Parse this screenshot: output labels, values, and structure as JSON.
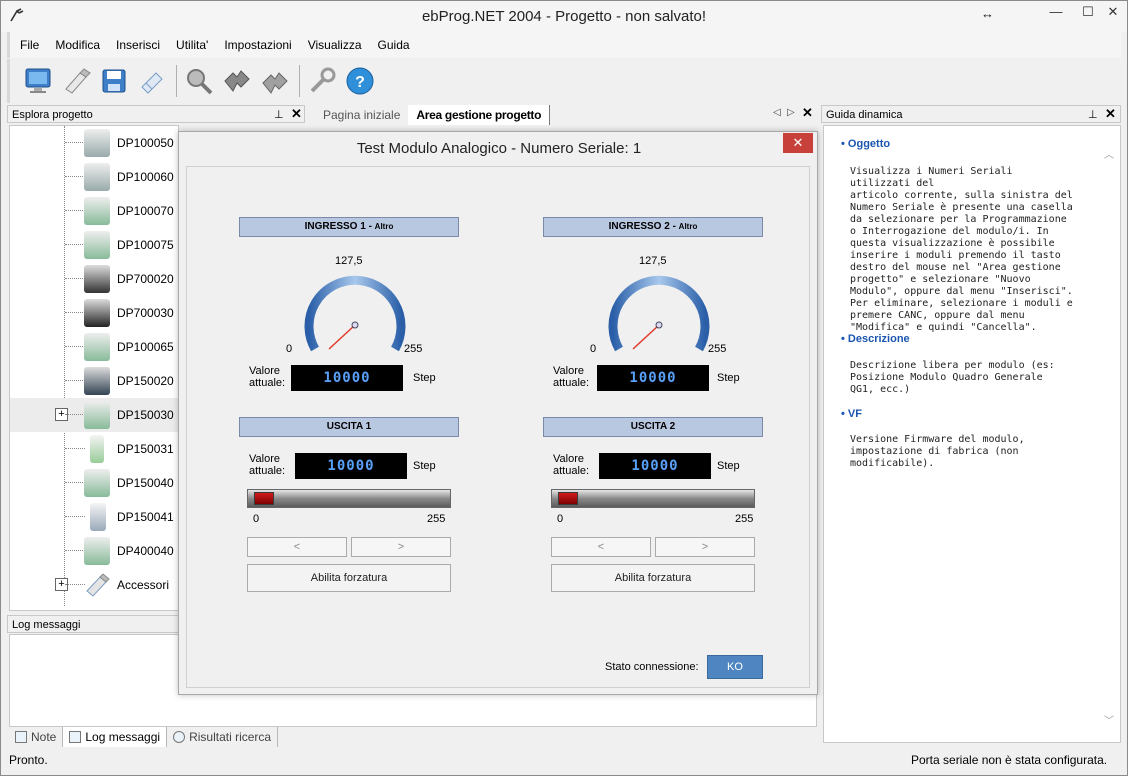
{
  "window": {
    "title": "ebProg.NET 2004 - Progetto - non salvato!"
  },
  "menu": [
    "File",
    "Modifica",
    "Inserisci",
    "Utilita'",
    "Impostazioni",
    "Visualizza",
    "Guida"
  ],
  "toolbar": [
    "monitor-icon",
    "usb-icon",
    "save-icon",
    "usb-eraser-icon",
    "search-icon",
    "puzzle-icon",
    "puzzle-gray-icon",
    "wrench-icon",
    "help-icon"
  ],
  "left_panel": {
    "title": "Esplora progetto",
    "items": [
      "DP100050",
      "DP100060",
      "DP100070",
      "DP100075",
      "DP700020",
      "DP700030",
      "DP100065",
      "DP150020",
      "DP150030",
      "DP150031",
      "DP150040",
      "DP150041",
      "DP400040",
      "Accessori"
    ]
  },
  "log_panel": {
    "title": "Log messaggi"
  },
  "bottom_tabs": [
    "Note",
    "Log messaggi",
    "Risultati ricerca"
  ],
  "doc_tabs": [
    "Pagina iniziale",
    "Area gestione progetto"
  ],
  "dialog": {
    "title": "Test Modulo Analogico - Numero Seriale: 1",
    "inputs": [
      {
        "header": "INGRESSO 1 - ",
        "header_small": "Altro",
        "min": "0",
        "mid": "127,5",
        "max": "255",
        "value": "10000",
        "value_label_line1": "Valore",
        "value_label_line2": "attuale:",
        "unit": "Step"
      },
      {
        "header": "INGRESSO 2 - ",
        "header_small": "Altro",
        "min": "0",
        "mid": "127,5",
        "max": "255",
        "value": "10000",
        "value_label_line1": "Valore",
        "value_label_line2": "attuale:",
        "unit": "Step"
      }
    ],
    "outputs": [
      {
        "header": "USCITA 1",
        "value": "10000",
        "value_label_line1": "Valore",
        "value_label_line2": "attuale:",
        "unit": "Step",
        "min": "0",
        "max": "255",
        "prev": "<",
        "next": ">",
        "force": "Abilita forzatura"
      },
      {
        "header": "USCITA 2",
        "value": "10000",
        "value_label_line1": "Valore",
        "value_label_line2": "attuale:",
        "unit": "Step",
        "min": "0",
        "max": "255",
        "prev": "<",
        "next": ">",
        "force": "Abilita forzatura"
      }
    ],
    "connection_label": "Stato connessione:",
    "connection_status": "KO"
  },
  "guide": {
    "title": "Guida dinamica",
    "sections": [
      {
        "heading": "Oggetto",
        "lines": [
          "Visualizza i Numeri Seriali utilizzati del",
          "articolo corrente, sulla sinistra del",
          "Numero Seriale è presente una casella",
          "da selezionare per la Programmazione",
          "o Interrogazione del modulo/i. In",
          "questa visualizzazione è possibile",
          "inserire i moduli premendo il tasto",
          "destro del mouse nel \"Area gestione",
          "progetto\" e selezionare \"Nuovo",
          "Modulo\", oppure dal menu \"Inserisci\".",
          "Per eliminare, selezionare i moduli e",
          "premere CANC, oppure dal menu",
          "\"Modifica\" e quindi \"Cancella\"."
        ]
      },
      {
        "heading": "Descrizione",
        "lines": [
          "Descrizione libera per modulo (es:",
          "Posizione Modulo Quadro Generale",
          "QG1, ecc.)"
        ]
      },
      {
        "heading": "VF",
        "lines": [
          "Versione Firmware del modulo,",
          "impostazione di fabrica (non",
          "modificabile)."
        ]
      }
    ]
  },
  "status": {
    "left": "Pronto.",
    "right": "Porta seriale non è stata configurata."
  }
}
